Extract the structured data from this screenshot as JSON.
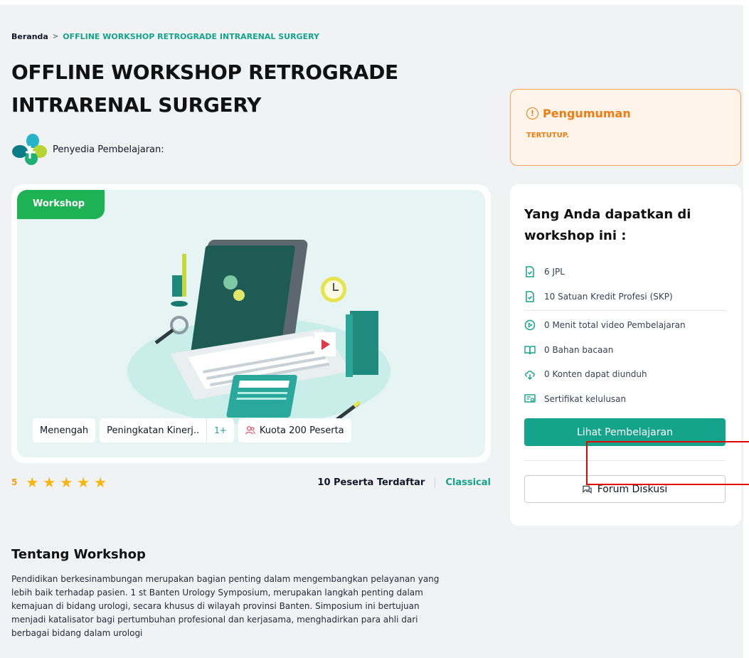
{
  "breadcrumb": {
    "home": "Beranda",
    "separator": ">",
    "current": "OFFLINE WORKSHOP RETROGRADE INTRARENAL SURGERY"
  },
  "title": "OFFLINE WORKSHOP RETROGRADE INTRARENAL SURGERY",
  "provider": {
    "label": "Penyedia Pembelajaran:"
  },
  "hero": {
    "badge": "Workshop",
    "tags": {
      "level": "Menengah",
      "category": "Peningkatan Kinerj..",
      "category_more": "1+",
      "quota": "Kuota 200 Peserta"
    }
  },
  "rating": {
    "score": "5",
    "stars": "★",
    "stars_count": 5
  },
  "meta": {
    "participants": "10 Peserta Terdaftar",
    "type": "Classical"
  },
  "about": {
    "title": "Tentang Workshop",
    "text": "Pendidikan berkesinambungan merupakan bagian penting dalam mengembangkan pelayanan yang lebih baik terhadap pasien. 1 st Banten Urology Symposium, merupakan langkah penting dalam kemajuan di bidang urologi, secara khusus di wilayah provinsi Banten. Simposium ini bertujuan menjadi katalisator bagi pertumbuhan profesional dan kerjasama, menghadirkan para ahli dari berbagai bidang dalam urologi"
  },
  "announcement": {
    "title": "Pengumuman",
    "status": "TERTUTUP."
  },
  "benefits": {
    "title": "Yang Anda dapatkan di workshop ini :",
    "items": [
      {
        "icon": "file-check-icon",
        "label": "6 JPL"
      },
      {
        "icon": "file-check-icon",
        "label": "10 Satuan Kredit Profesi (SKP)"
      },
      {
        "icon": "play-circle-icon",
        "label": "0 Menit total video Pembelajaran"
      },
      {
        "icon": "book-open-icon",
        "label": "0 Bahan bacaan"
      },
      {
        "icon": "cloud-download-icon",
        "label": "0 Konten dapat diunduh"
      },
      {
        "icon": "certificate-icon",
        "label": "Sertifikat kelulusan"
      }
    ],
    "primary_button": "Lihat Pembelajaran",
    "forum_button": "Forum Diskusi"
  },
  "colors": {
    "accent": "#14a38b",
    "badge": "#1fb254",
    "announce": "#f07c12",
    "star": "#f6b60c"
  }
}
